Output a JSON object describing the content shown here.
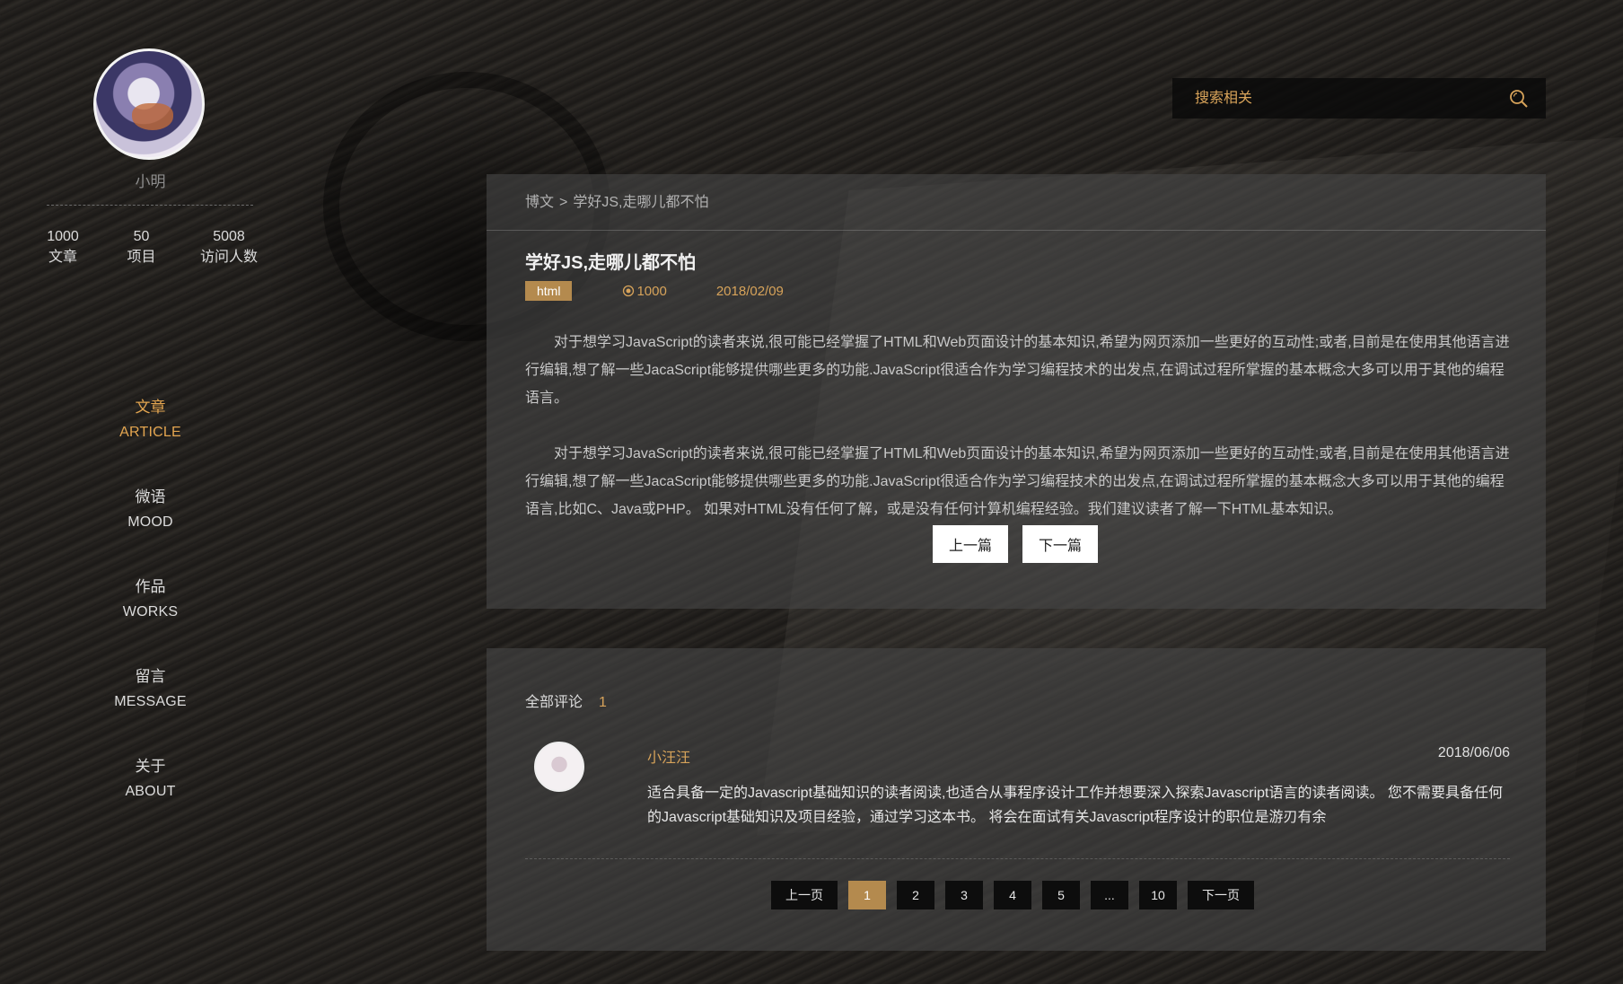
{
  "profile": {
    "name": "小明",
    "stats": [
      {
        "value": "1000",
        "label": "文章"
      },
      {
        "value": "50",
        "label": "项目"
      },
      {
        "value": "5008",
        "label": "访问人数"
      }
    ]
  },
  "nav": [
    {
      "zh": "文章",
      "en": "ARTICLE",
      "active": true
    },
    {
      "zh": "微语",
      "en": "MOOD"
    },
    {
      "zh": "作品",
      "en": "WORKS"
    },
    {
      "zh": "留言",
      "en": "MESSAGE"
    },
    {
      "zh": "关于",
      "en": "ABOUT"
    }
  ],
  "search": {
    "placeholder": "搜索相关",
    "icon": "search-icon"
  },
  "article": {
    "breadcrumb_root": "博文",
    "breadcrumb_sep": ">",
    "breadcrumb_current": "学好JS,走哪儿都不怕",
    "title": "学好JS,走哪儿都不怕",
    "tag": "html",
    "views": "1000",
    "date": "2018/02/09",
    "paragraphs": [
      "对于想学习JavaScript的读者来说,很可能已经掌握了HTML和Web页面设计的基本知识,希望为网页添加一些更好的互动性;或者,目前是在使用其他语言进行编辑,想了解一些JacaScript能够提供哪些更多的功能.JavaScript很适合作为学习编程技术的出发点,在调试过程所掌握的基本概念大多可以用于其他的编程语言。",
      "对于想学习JavaScript的读者来说,很可能已经掌握了HTML和Web页面设计的基本知识,希望为网页添加一些更好的互动性;或者,目前是在使用其他语言进行编辑,想了解一些JacaScript能够提供哪些更多的功能.JavaScript很适合作为学习编程技术的出发点,在调试过程所掌握的基本概念大多可以用于其他的编程语言,比如C、Java或PHP。 如果对HTML没有任何了解，或是没有任何计算机编程经验。我们建议读者了解一下HTML基本知识。"
    ],
    "prev_label": "上一篇",
    "next_label": "下一篇"
  },
  "comments": {
    "heading": "全部评论",
    "count": "1",
    "items": [
      {
        "author": "小汪汪",
        "date": "2018/06/06",
        "text": "适合具备一定的Javascript基础知识的读者阅读,也适合从事程序设计工作并想要深入探索Javascript语言的读者阅读。 您不需要具备任何的Javascript基础知识及项目经验，通过学习这本书。 将会在面试有关Javascript程序设计的职位是游刃有余"
      }
    ],
    "pagination": {
      "prev": "上一页",
      "pages": [
        "1",
        "2",
        "3",
        "4",
        "5",
        "...",
        "10"
      ],
      "current": "1",
      "next": "下一页"
    }
  },
  "colors": {
    "accent": "#d7a35a",
    "tag_bg": "#b48a4e"
  }
}
